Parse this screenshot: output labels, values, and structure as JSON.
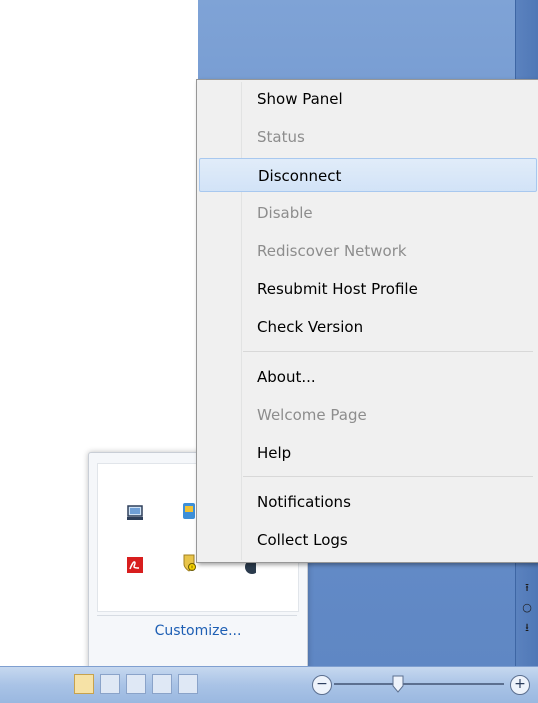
{
  "context_menu": {
    "items": [
      {
        "label": "Show Panel",
        "enabled": true
      },
      {
        "label": "Status",
        "enabled": false
      },
      {
        "label": "Disconnect",
        "enabled": true,
        "highlighted": true
      },
      {
        "label": "Disable",
        "enabled": false
      },
      {
        "label": "Rediscover Network",
        "enabled": false
      },
      {
        "label": "Resubmit Host Profile",
        "enabled": true
      },
      {
        "label": "Check Version",
        "enabled": true
      },
      {
        "label": "About...",
        "enabled": true
      },
      {
        "label": "Welcome Page",
        "enabled": false
      },
      {
        "label": "Help",
        "enabled": true
      },
      {
        "label": "Notifications",
        "enabled": true
      },
      {
        "label": "Collect Logs",
        "enabled": true
      }
    ]
  },
  "tray_flyout": {
    "customize_label": "Customize...",
    "icons": [
      "laptop-icon",
      "network-agent-icon",
      "acrobat-icon",
      "shield-warning-icon",
      "app-globe-icon"
    ]
  },
  "taskbar": {
    "zoom": {}
  },
  "colors": {
    "menu_background": "#f0f0f0",
    "highlight": "#d2e3f7",
    "disabled_text": "#8d8d8d",
    "link": "#1e5fb4"
  }
}
